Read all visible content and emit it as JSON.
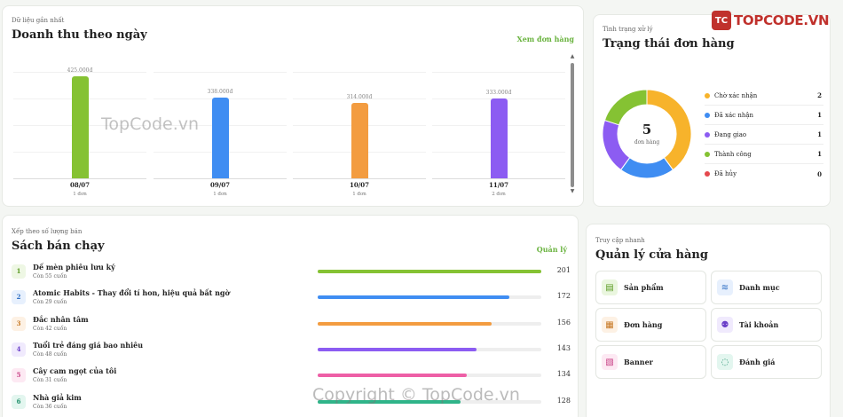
{
  "revenue": {
    "eyebrow": "Dữ liệu gần nhất",
    "title": "Doanh thu theo ngày",
    "link": "Xem đơn hàng",
    "chart_data": {
      "type": "bar",
      "categories": [
        "08/07",
        "09/07",
        "10/07",
        "11/07"
      ],
      "values": [
        425000,
        338000,
        314000,
        333000
      ],
      "value_labels": [
        "425.000đ",
        "338.000đ",
        "314.000đ",
        "333.000đ"
      ],
      "order_counts": [
        "1 đơn",
        "1 đơn",
        "1 đơn",
        "2 đơn"
      ],
      "colors": [
        "#85c233",
        "#3f8df2",
        "#f39c40",
        "#8c5cf2"
      ],
      "title": "Doanh thu theo ngày",
      "ylim": [
        0,
        425000
      ]
    }
  },
  "status": {
    "eyebrow": "Tình trạng xử lý",
    "title": "Trạng thái đơn hàng",
    "total": "5",
    "total_label": "đơn hàng",
    "chart_data": {
      "type": "pie",
      "categories": [
        "Chờ xác nhận",
        "Đã xác nhận",
        "Đang giao",
        "Thành công",
        "Đã hủy"
      ],
      "values": [
        2,
        1,
        1,
        1,
        0
      ],
      "colors": [
        "#f7b32b",
        "#3f8df2",
        "#8c5cf2",
        "#85c233",
        "#e5484d"
      ]
    },
    "items": [
      {
        "label": "Chờ xác nhận",
        "value": "2",
        "color": "#f7b32b"
      },
      {
        "label": "Đã xác nhận",
        "value": "1",
        "color": "#3f8df2"
      },
      {
        "label": "Đang giao",
        "value": "1",
        "color": "#8c5cf2"
      },
      {
        "label": "Thành công",
        "value": "1",
        "color": "#85c233"
      },
      {
        "label": "Đã hủy",
        "value": "0",
        "color": "#e5484d"
      }
    ]
  },
  "bestsellers": {
    "eyebrow": "Xếp theo số lượng bán",
    "title": "Sách bán chạy",
    "link": "Quản lý",
    "max": 201,
    "items": [
      {
        "rank": "1",
        "title": "Dế mèn phiêu lưu ký",
        "stock": "Còn 55 cuốn",
        "sold": "201",
        "value": 201,
        "color": "#85c233",
        "badge_bg": "#eef7e4",
        "badge_fg": "#5a9a22"
      },
      {
        "rank": "2",
        "title": "Atomic Habits - Thay đổi tí hon, hiệu quả bất ngờ",
        "stock": "Còn 29 cuốn",
        "sold": "172",
        "value": 172,
        "color": "#3f8df2",
        "badge_bg": "#e7f0fd",
        "badge_fg": "#2f6fc4"
      },
      {
        "rank": "3",
        "title": "Đắc nhân tâm",
        "stock": "Còn 42 cuốn",
        "sold": "156",
        "value": 156,
        "color": "#f39c40",
        "badge_bg": "#fdf1e4",
        "badge_fg": "#c67722"
      },
      {
        "rank": "4",
        "title": "Tuổi trẻ đáng giá bao nhiêu",
        "stock": "Còn 48 cuốn",
        "sold": "143",
        "value": 143,
        "color": "#8c5cf2",
        "badge_bg": "#f0eafd",
        "badge_fg": "#6c41c9"
      },
      {
        "rank": "5",
        "title": "Cây cam ngọt của tôi",
        "stock": "Còn 31 cuốn",
        "sold": "134",
        "value": 134,
        "color": "#ee5fa6",
        "badge_bg": "#fde9f3",
        "badge_fg": "#c73f84"
      },
      {
        "rank": "6",
        "title": "Nhà giả kim",
        "stock": "Còn 36 cuốn",
        "sold": "128",
        "value": 128,
        "color": "#2fb489",
        "badge_bg": "#e3f6ef",
        "badge_fg": "#21916c"
      }
    ]
  },
  "quick": {
    "eyebrow": "Truy cập nhanh",
    "title": "Quản lý cửa hàng",
    "buttons": [
      {
        "label": "Sản phẩm",
        "icon": "book-icon",
        "bg": "#eaf6df",
        "fg": "#5a9a22",
        "glyph": "▤"
      },
      {
        "label": "Danh mục",
        "icon": "layers-icon",
        "bg": "#e7f0fd",
        "fg": "#2f6fc4",
        "glyph": "≋"
      },
      {
        "label": "Đơn hàng",
        "icon": "receipt-icon",
        "bg": "#fdf1e4",
        "fg": "#c67722",
        "glyph": "▦"
      },
      {
        "label": "Tài khoản",
        "icon": "users-icon",
        "bg": "#f0eafd",
        "fg": "#6c41c9",
        "glyph": "⚉"
      },
      {
        "label": "Banner",
        "icon": "image-icon",
        "bg": "#fde9f3",
        "fg": "#c73f84",
        "glyph": "▧"
      },
      {
        "label": "Đánh giá",
        "icon": "chat-icon",
        "bg": "#e3f6ef",
        "fg": "#21916c",
        "glyph": "◌"
      }
    ]
  },
  "watermark": {
    "logo_badge": "TC",
    "logo_text": "TOPCODE.VN",
    "text1": "TopCode.vn",
    "text2": "Copyright © TopCode.vn"
  }
}
